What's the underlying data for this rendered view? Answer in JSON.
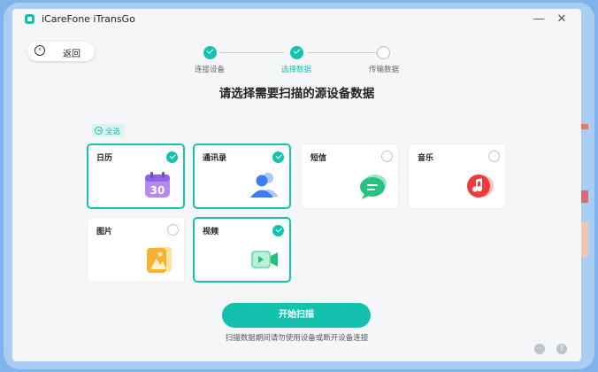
{
  "app": {
    "title": "iCareFone iTransGo"
  },
  "window_controls": {
    "minimize": "—",
    "close": "✕"
  },
  "back_button": {
    "label": "返回"
  },
  "stepper": {
    "steps": [
      {
        "label": "连接设备",
        "status": "done"
      },
      {
        "label": "选择数据",
        "status": "done"
      },
      {
        "label": "传输数据",
        "status": "todo"
      }
    ]
  },
  "heading": "请选择需要扫描的源设备数据",
  "select_all": {
    "label": "全选"
  },
  "categories": [
    {
      "label": "日历",
      "selected": true,
      "icon": "calendar-icon",
      "icon_text": "30"
    },
    {
      "label": "通讯录",
      "selected": true,
      "icon": "contacts-icon"
    },
    {
      "label": "短信",
      "selected": false,
      "icon": "messages-icon"
    },
    {
      "label": "音乐",
      "selected": false,
      "icon": "music-icon"
    },
    {
      "label": "图片",
      "selected": false,
      "icon": "photos-icon"
    },
    {
      "label": "视频",
      "selected": true,
      "icon": "video-icon"
    }
  ],
  "start_button": {
    "label": "开始扫描"
  },
  "hint": "扫描数据期间请勿使用设备或断开设备连接",
  "footer": {
    "feedback": "···",
    "help": "?"
  },
  "colors": {
    "accent": "#12c2ae",
    "background": "#f4f6f8"
  }
}
